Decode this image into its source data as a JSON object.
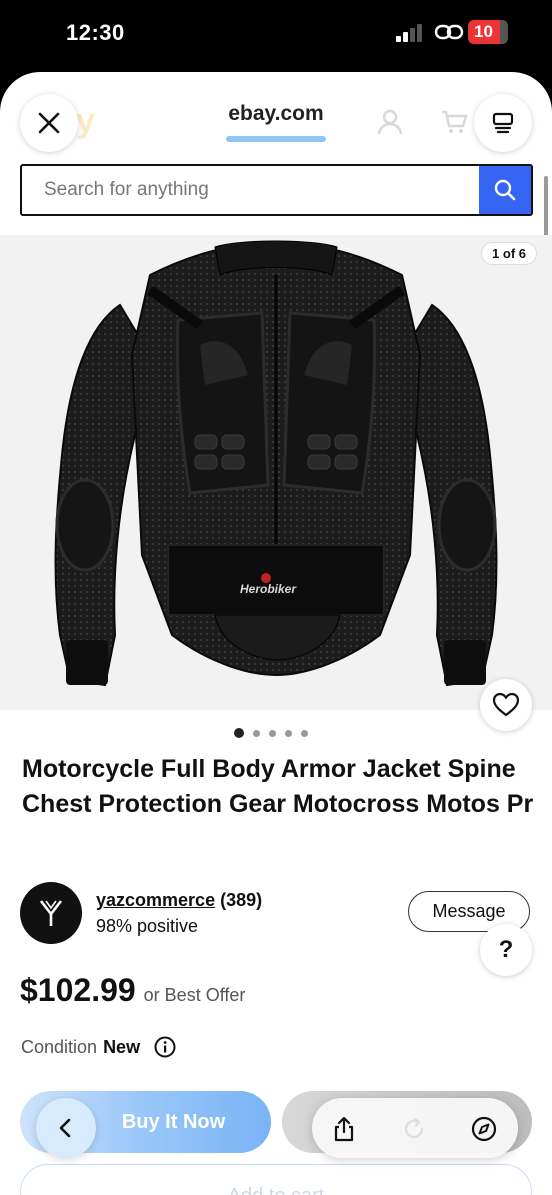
{
  "status_bar": {
    "time": "12:30",
    "battery": "10"
  },
  "browser": {
    "url": "ebay.com"
  },
  "search": {
    "placeholder": "Search for anything"
  },
  "gallery": {
    "counter": "1 of 6",
    "dot_count": 5,
    "active_index": 0,
    "brand_mark": "Herobiker"
  },
  "product": {
    "title": "Motorcycle Full Body Armor Jacket Spine Chest Protection Gear Motocross Motos Pr",
    "price": "$102.99",
    "offer_text": "or Best Offer",
    "condition_label": "Condition",
    "condition_value": "New"
  },
  "seller": {
    "name": "yazcommerce",
    "feedback_count": "(389)",
    "positive": "98% positive",
    "message_label": "Message"
  },
  "help": {
    "label": "?"
  },
  "actions": {
    "buy_now": "Buy It Now",
    "add_to_cart": "Add to cart"
  },
  "colors": {
    "brand_blue": "#3665f3",
    "accent_light_blue": "#8ec6f5"
  },
  "icons": [
    "close-icon",
    "tabs-icon",
    "search-icon",
    "heart-icon",
    "info-icon",
    "back-chevron-icon",
    "share-icon",
    "reload-icon",
    "compass-icon"
  ]
}
